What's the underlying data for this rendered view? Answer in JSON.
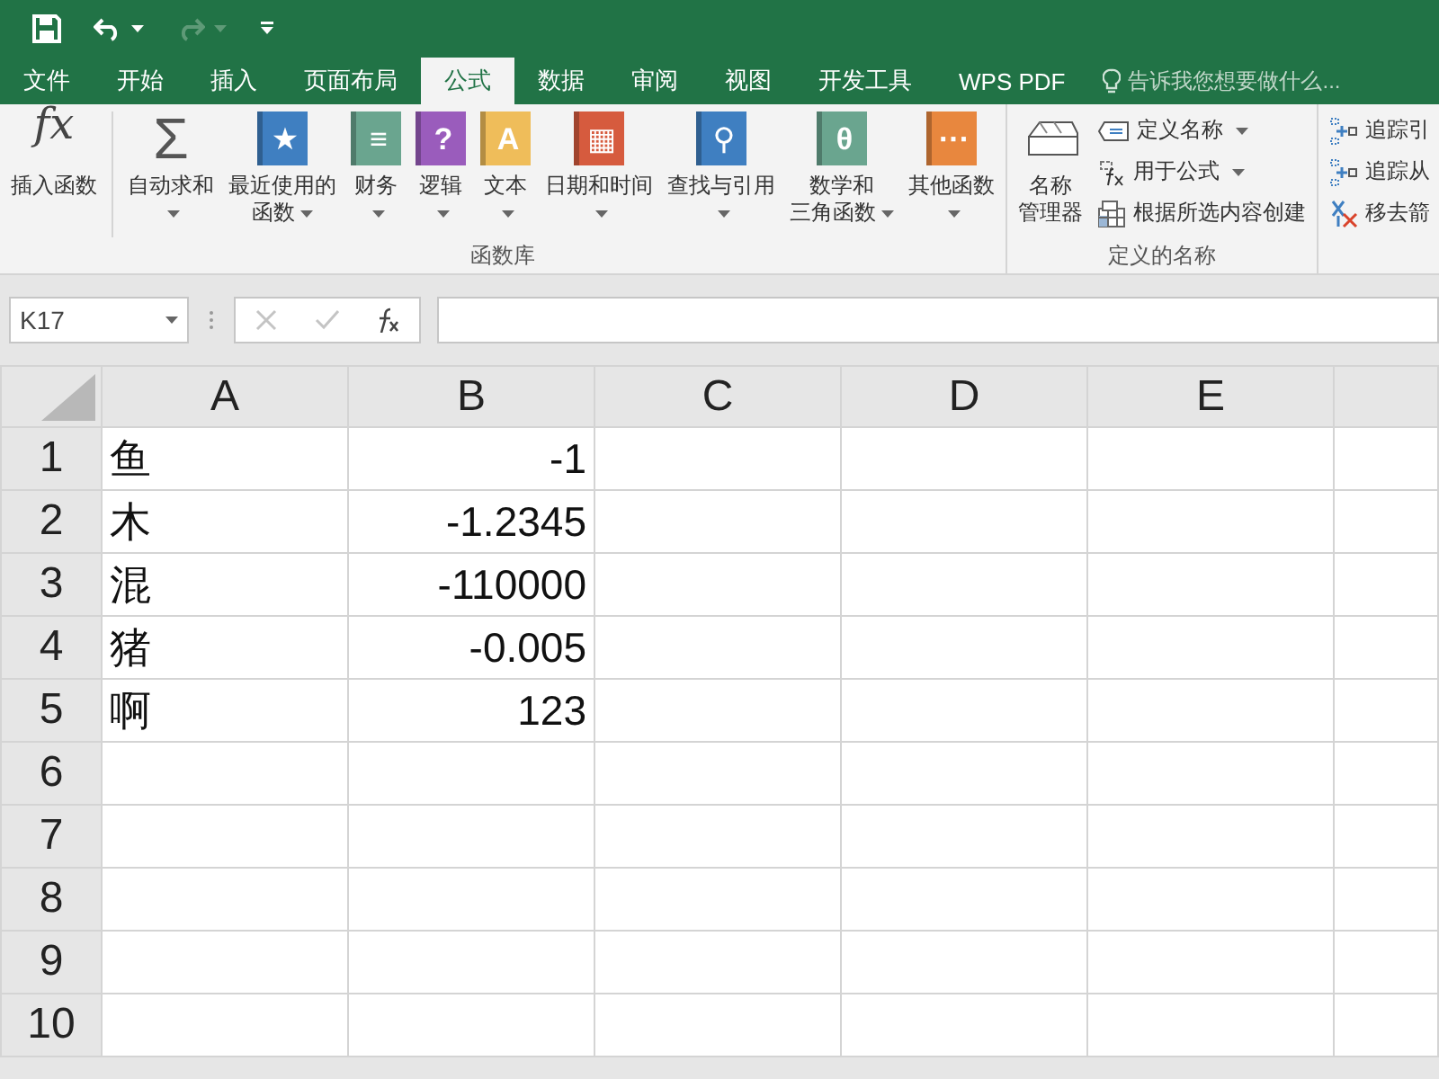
{
  "quick_access": [
    {
      "kind": "save",
      "disabled": false
    },
    {
      "kind": "undo",
      "disabled": false
    },
    {
      "kind": "redo",
      "disabled": true
    },
    {
      "kind": "customize",
      "disabled": false
    }
  ],
  "tabs": [
    {
      "label": "文件",
      "selected": false
    },
    {
      "label": "开始",
      "selected": false
    },
    {
      "label": "插入",
      "selected": false
    },
    {
      "label": "页面布局",
      "selected": false
    },
    {
      "label": "公式",
      "selected": true
    },
    {
      "label": "数据",
      "selected": false
    },
    {
      "label": "审阅",
      "selected": false
    },
    {
      "label": "视图",
      "selected": false
    },
    {
      "label": "开发工具",
      "selected": false
    },
    {
      "label": "WPS PDF",
      "selected": false
    }
  ],
  "tell_me": {
    "placeholder": "告诉我您想要做什么..."
  },
  "ribbon": {
    "groups": [
      {
        "label": "函数库",
        "items": [
          {
            "kind": "fx",
            "glyph": "fx",
            "lines": [
              "插入函数"
            ],
            "dropdown": false
          },
          {
            "kind": "sigma",
            "glyph": "Σ",
            "lines": [
              "自动求和"
            ],
            "dropdown": true
          },
          {
            "kind": "book",
            "glyph": "★",
            "color": "#3f7fc1",
            "lines": [
              "最近使用的",
              "函数"
            ],
            "dropdown": true
          },
          {
            "kind": "book",
            "glyph": "≡",
            "color": "#6aa58f",
            "lines": [
              "财务"
            ],
            "dropdown": true
          },
          {
            "kind": "book",
            "glyph": "?",
            "color": "#9a5cbc",
            "lines": [
              "逻辑"
            ],
            "dropdown": true
          },
          {
            "kind": "book",
            "glyph": "A",
            "color": "#efbd5a",
            "lines": [
              "文本"
            ],
            "dropdown": true
          },
          {
            "kind": "book",
            "glyph": "▦",
            "color": "#d65b3e",
            "lines": [
              "日期和时间"
            ],
            "dropdown": true
          },
          {
            "kind": "book",
            "glyph": "⚲",
            "color": "#3f7fc1",
            "lines": [
              "查找与引用"
            ],
            "dropdown": true
          },
          {
            "kind": "book",
            "glyph": "θ",
            "color": "#6aa58f",
            "lines": [
              "数学和",
              "三角函数"
            ],
            "dropdown": true
          },
          {
            "kind": "book",
            "glyph": "···",
            "color": "#e8873e",
            "lines": [
              "其他函数"
            ],
            "dropdown": true
          }
        ]
      },
      {
        "label": "定义的名称",
        "items": [
          {
            "kind": "names",
            "lines": [
              "名称",
              "管理器"
            ],
            "dropdown": false
          },
          {
            "kind": "column",
            "items": [
              {
                "kind": "tag",
                "label": "定义名称",
                "dropdown": true
              },
              {
                "kind": "formula",
                "label": "用于公式",
                "dropdown": true
              },
              {
                "kind": "grid",
                "label": "根据所选内容创建",
                "dropdown": false
              }
            ]
          }
        ]
      },
      {
        "items": [
          {
            "kind": "column",
            "items": [
              {
                "kind": "trace",
                "label": "追踪引",
                "dropdown": false
              },
              {
                "kind": "trace",
                "label": "追踪从",
                "dropdown": false
              },
              {
                "kind": "remove",
                "label": "移去箭",
                "dropdown": false
              }
            ]
          }
        ]
      }
    ]
  },
  "formula_bar": {
    "name_box": "K17",
    "buttons": [
      {
        "kind": "cancel",
        "disabled": true
      },
      {
        "kind": "enter",
        "disabled": true
      },
      {
        "kind": "function",
        "disabled": false
      }
    ]
  },
  "sheet": {
    "columns": [
      "A",
      "B",
      "C",
      "D",
      "E"
    ],
    "rows": [
      {
        "header": "1",
        "cells": [
          "鱼",
          "-1"
        ]
      },
      {
        "header": "2",
        "cells": [
          "木",
          "-1.2345"
        ]
      },
      {
        "header": "3",
        "cells": [
          "混",
          "-110000"
        ]
      },
      {
        "header": "4",
        "cells": [
          "猪",
          "-0.005"
        ]
      },
      {
        "header": "5",
        "cells": [
          "啊",
          "123"
        ]
      },
      {
        "header": "6",
        "cells": []
      },
      {
        "header": "7",
        "cells": []
      },
      {
        "header": "8",
        "cells": []
      },
      {
        "header": "9",
        "cells": []
      },
      {
        "header": "10",
        "cells": []
      }
    ]
  }
}
